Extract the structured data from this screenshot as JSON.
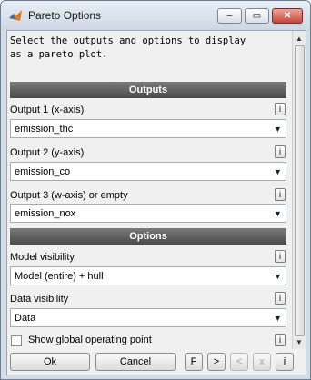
{
  "window": {
    "title": "Pareto Options",
    "min_glyph": "–",
    "max_glyph": "▭",
    "close_glyph": "✕"
  },
  "description": "Select the outputs and options to display\nas a pareto plot.",
  "outputs": {
    "header": "Outputs",
    "fields": [
      {
        "label": "Output 1 (x-axis)",
        "value": "emission_thc"
      },
      {
        "label": "Output 2 (y-axis)",
        "value": "emission_co"
      },
      {
        "label": "Output 3 (w-axis) or empty",
        "value": "emission_nox"
      }
    ]
  },
  "options": {
    "header": "Options",
    "model_visibility": {
      "label": "Model visibility",
      "value": "Model (entire) + hull"
    },
    "data_visibility": {
      "label": "Data visibility",
      "value": "Data"
    },
    "show_global": {
      "label": "Show global operating point",
      "checked": false
    }
  },
  "info_glyph": "i",
  "dropdown_glyph": "▼",
  "scroll": {
    "up": "▲",
    "down": "▼"
  },
  "buttons": {
    "ok": "Ok",
    "cancel": "Cancel",
    "f": "F",
    "next": ">",
    "prev": "<",
    "x": "x",
    "i": "i"
  }
}
